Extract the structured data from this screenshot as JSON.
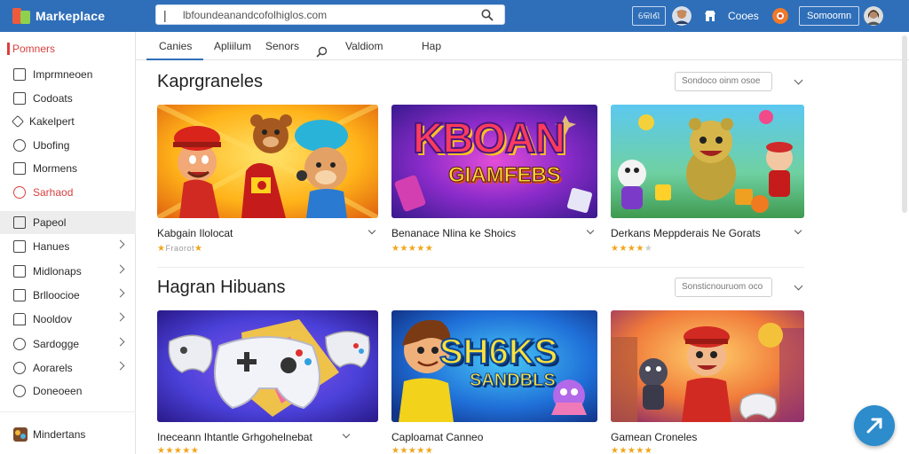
{
  "app": {
    "name": "Markeplace"
  },
  "search": {
    "value": "lbfoundeanandcofolhiglos.com"
  },
  "topbar": {
    "btn_short": "କୋଣ",
    "label_mid": "Cooes",
    "btn_right": "Somoomn"
  },
  "sidebar": {
    "items": [
      {
        "label": "Pomners"
      },
      {
        "label": "Imprmneoen"
      },
      {
        "label": "Codoats"
      },
      {
        "label": "Kakelpert"
      },
      {
        "label": "Ubofing"
      },
      {
        "label": "Mormens"
      },
      {
        "label": "Sarhaod"
      },
      {
        "label": "Papeol"
      },
      {
        "label": "Hanues"
      },
      {
        "label": "Midlonaps"
      },
      {
        "label": "Brlloocioe"
      },
      {
        "label": "Nooldov"
      },
      {
        "label": "Sardogge"
      },
      {
        "label": "Aorarels"
      },
      {
        "label": "Doneoeen"
      },
      {
        "label": "Mindertans"
      }
    ]
  },
  "tabs": [
    {
      "label": "Canies"
    },
    {
      "label": "Apliilum"
    },
    {
      "label": "Senors"
    },
    {
      "label": "Valdiom"
    },
    {
      "label": "Hap"
    }
  ],
  "sections": [
    {
      "title": "Kaprgraneles",
      "sort_label": "Sondoco oinm osoe",
      "cards": [
        {
          "title": "Kabgain Ilolocat",
          "rating_text": "Fraorot"
        },
        {
          "title": "Benanace Nlina ke Shoics",
          "art_line1": "KBOAN",
          "art_line2": "GIAMFEBS"
        },
        {
          "title": "Derkans Meppderais Ne Gorats"
        }
      ]
    },
    {
      "title": "Hagran Hibuans",
      "sort_label": "Sonsticnouruom oco",
      "cards": [
        {
          "title": "Ineceann Ihtantle Grhgohelnebat"
        },
        {
          "title": "Caploamat Canneo",
          "art_line1": "SH6KS",
          "art_line2": "SANDBLS"
        },
        {
          "title": "Gamean Croneles"
        }
      ]
    }
  ],
  "colors": {
    "brand": "#2f6fb9",
    "star": "#f2a51a",
    "accent_red": "#d94040",
    "fab": "#2c8ccc"
  }
}
